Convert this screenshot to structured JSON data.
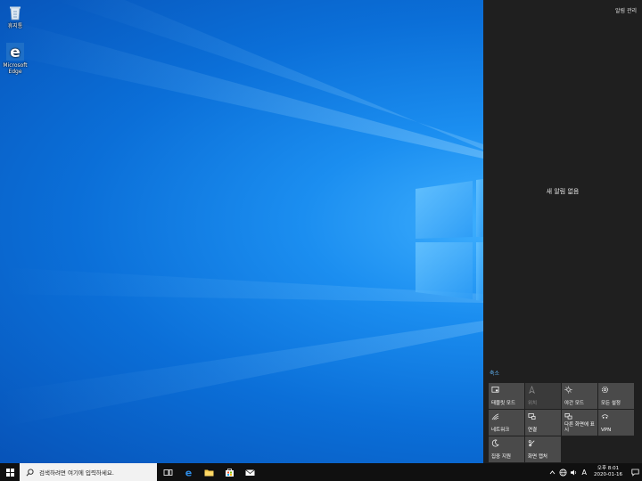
{
  "desktop": {
    "icons": [
      {
        "label": "휴지통",
        "icon": "recycle-bin-icon"
      },
      {
        "label": "Microsoft Edge",
        "icon": "edge-icon"
      }
    ]
  },
  "action_center": {
    "manage_label": "알림 관리",
    "empty_label": "새 알림 없음",
    "collapse_label": "축소",
    "tiles": [
      {
        "label": "태블릿 모드",
        "icon": "tablet-mode-icon",
        "enabled": true
      },
      {
        "label": "위치",
        "icon": "location-icon",
        "enabled": false
      },
      {
        "label": "야간 모드",
        "icon": "night-light-icon",
        "enabled": true
      },
      {
        "label": "모든 설정",
        "icon": "settings-icon",
        "enabled": true
      },
      {
        "label": "네트워크",
        "icon": "network-icon",
        "enabled": true
      },
      {
        "label": "연결",
        "icon": "connect-icon",
        "enabled": true
      },
      {
        "label": "다른 화면에 표시",
        "icon": "project-icon",
        "enabled": true
      },
      {
        "label": "VPN",
        "icon": "vpn-icon",
        "enabled": true
      },
      {
        "label": "집중 지원",
        "icon": "focus-assist-icon",
        "enabled": true
      },
      {
        "label": "화면 캡처",
        "icon": "screen-snip-icon",
        "enabled": true
      }
    ]
  },
  "taskbar": {
    "search_placeholder": "검색하려면 여기에 입력하세요.",
    "apps": [
      "task-view-icon",
      "edge-icon",
      "file-explorer-icon",
      "store-icon",
      "mail-icon"
    ],
    "ime_label": "A",
    "clock_time": "오후 8:01",
    "clock_date": "2020-01-16"
  },
  "colors": {
    "accent": "#0078d7",
    "panel": "#1f1f1f",
    "tile": "#4a4a4a",
    "link": "#5fb2f2"
  }
}
